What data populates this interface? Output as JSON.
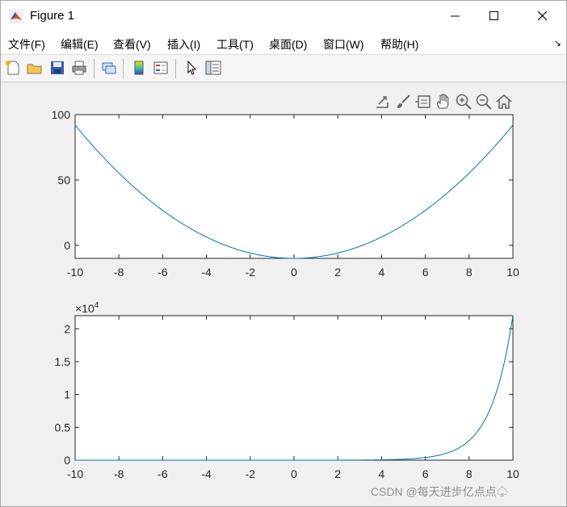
{
  "window": {
    "title": "Figure 1"
  },
  "menu": {
    "items": [
      "文件(F)",
      "编辑(E)",
      "查看(V)",
      "插入(I)",
      "工具(T)",
      "桌面(D)",
      "窗口(W)",
      "帮助(H)"
    ]
  },
  "toolbar": {
    "buttons": [
      "new-figure-icon",
      "open-file-icon",
      "save-icon",
      "print-icon",
      "link-plot-icon",
      "colorbar-icon",
      "legend-icon",
      "pointer-icon",
      "property-inspector-icon"
    ]
  },
  "axes_toolbar": {
    "buttons": [
      "export-icon",
      "brush-icon",
      "data-tips-icon",
      "pan-icon",
      "zoom-in-icon",
      "zoom-out-icon",
      "home-icon"
    ]
  },
  "colors": {
    "line": "#0072BD",
    "axes_bg": "#ffffff",
    "figure_bg": "#f0f0f0"
  },
  "chart_data": [
    {
      "type": "line",
      "function_shape": "parabola",
      "x": [
        -10,
        -8,
        -6,
        -4,
        -2,
        0,
        2,
        4,
        6,
        8,
        10
      ],
      "series": [
        {
          "values": [
            92,
            55,
            25,
            7,
            -7,
            -10,
            -5,
            8,
            26,
            54,
            92
          ]
        }
      ],
      "xlim": [
        -10,
        10
      ],
      "ylim": [
        -10,
        100
      ],
      "xticks": [
        "-10",
        "-8",
        "-6",
        "-4",
        "-2",
        "0",
        "2",
        "4",
        "6",
        "8",
        "10"
      ],
      "yticks": [
        "0",
        "50",
        "100"
      ],
      "grid": false
    },
    {
      "type": "line",
      "function_shape": "exponential",
      "x": [
        -10,
        -6,
        -2,
        0,
        2,
        4,
        5,
        6,
        7,
        8,
        8.5,
        9,
        9.5,
        10
      ],
      "series": [
        {
          "values": [
            0,
            0,
            0.0001,
            0.0001,
            0.0007,
            0.0055,
            0.0148,
            0.0403,
            0.1097,
            0.2981,
            0.4915,
            0.8103,
            1.336,
            2.2026
          ]
        }
      ],
      "xlim": [
        -10,
        10
      ],
      "ylim": [
        0,
        2.2
      ],
      "xticks": [
        "-10",
        "-8",
        "-6",
        "-4",
        "-2",
        "0",
        "2",
        "4",
        "6",
        "8",
        "10"
      ],
      "yticks": [
        "0",
        "0.5",
        "1",
        "1.5",
        "2"
      ],
      "yexponent": "×10",
      "yexponent_power": "4",
      "grid": false
    }
  ],
  "watermark": "CSDN @每天进步亿点点♤"
}
